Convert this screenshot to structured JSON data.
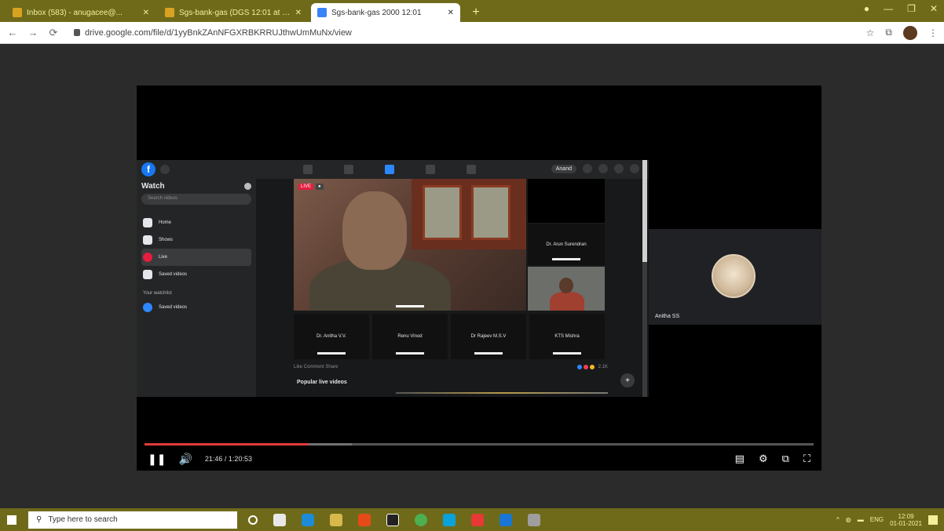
{
  "browser": {
    "tabs": [
      {
        "label": "Inbox (583) - anugacee@..."
      },
      {
        "label": "Sgs-bank-gas (DGS 12:01 at t..."
      },
      {
        "label": "Sgs-bank-gas 2000 12:01"
      }
    ],
    "new_tab": "+",
    "url": "drive.google.com/file/d/1yyBnkZAnNFGXRBKRRUJthwUmMuNx/view",
    "window_controls": [
      "—",
      "❐",
      "✕"
    ]
  },
  "fb": {
    "logo": "f",
    "sidebar": {
      "title": "Watch",
      "search_placeholder": "Search videos",
      "items": [
        {
          "label": "Home"
        },
        {
          "label": "Shows"
        },
        {
          "label": "Live"
        },
        {
          "label": "Saved videos"
        }
      ],
      "section_label": "Your watchlist",
      "watchlist_items": [
        {
          "label": "Saved videos"
        }
      ]
    },
    "topbar_pill": "Anand",
    "tiles": [
      {
        "label": "Dr. Anitha V.V."
      },
      {
        "label": "Renu Vinod"
      },
      {
        "label": "Dr Rajeev M.S.V"
      },
      {
        "label": "KTS Mishra"
      }
    ],
    "top_right_tile": {
      "label": "Dr. Arun Surendran"
    },
    "strip": {
      "left": "Like  Comment  Share",
      "right": "2.1K"
    },
    "popular_label": "Popular live videos"
  },
  "meet": {
    "participant_name": "Anitha SS"
  },
  "player": {
    "time": "21:46 / 1:20:53",
    "progress_fraction": 0.245,
    "loaded_fraction": 0.31
  },
  "taskbar": {
    "search_placeholder": "Type here to search",
    "lang": "ENG",
    "time": "12:09",
    "date": "01-01-2021"
  },
  "colors": {
    "chrome": "#6f6a1a",
    "progress": "#ff0000",
    "fb_blue": "#1877f2"
  }
}
